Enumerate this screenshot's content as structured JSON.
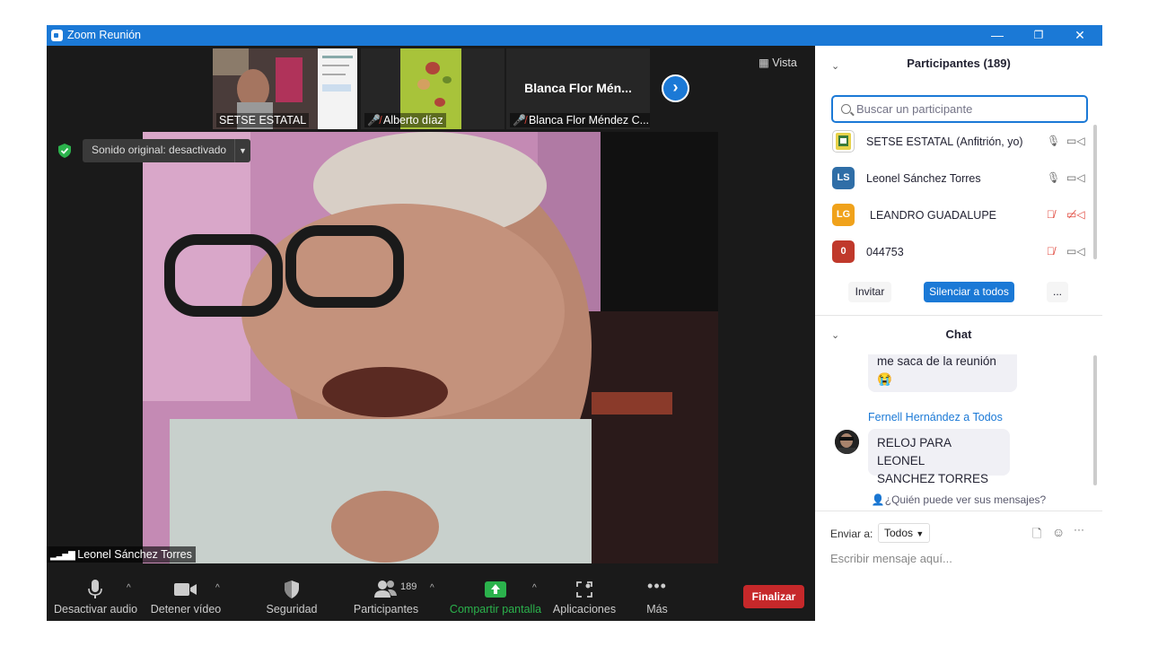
{
  "window": {
    "title": "Zoom Reunión",
    "minimize": "—",
    "restore": "❐",
    "close": "✕"
  },
  "thumbnails": [
    {
      "name": "SETSE ESTATAL",
      "muted": false
    },
    {
      "name": "Alberto díaz",
      "muted": true
    },
    {
      "name": "Blanca Flor Méndez C...",
      "muted": true,
      "display_name": "Blanca Flor Mén..."
    }
  ],
  "view_label": "Vista",
  "original_sound": "Sonido original: desactivado",
  "speaker_name": "Leonel Sánchez Torres",
  "toolbar": {
    "audio": "Desactivar audio",
    "video": "Detener vídeo",
    "security": "Seguridad",
    "participants": "Participantes",
    "participants_count": "189",
    "share": "Compartir pantalla",
    "apps": "Aplicaciones",
    "more": "Más",
    "end": "Finalizar"
  },
  "participants_panel": {
    "title": "Participantes (189)",
    "search_placeholder": "Buscar un participante",
    "participants": [
      {
        "name": "SETSE ESTATAL (Anfitrión, yo)",
        "initials": "",
        "color": "#c9b23a",
        "audio_muted": false,
        "video_off": false
      },
      {
        "name": "Leonel Sánchez Torres",
        "initials": "LS",
        "color": "#2f6ea7",
        "audio_muted": false,
        "video_off": false
      },
      {
        "name": "LEANDRO GUADALUPE",
        "initials": "LG",
        "color": "#f0a21b",
        "audio_muted": true,
        "video_off": true
      },
      {
        "name": "044753",
        "initials": "0",
        "color": "#c0392b",
        "audio_muted": true,
        "video_off": false
      }
    ],
    "invite": "Invitar",
    "mute_all": "Silenciar a todos",
    "more": "..."
  },
  "chat": {
    "title": "Chat",
    "messages": [
      {
        "text": "me saca de la reunión",
        "emoji": "😭"
      },
      {
        "sender": "Fernell Hernández a Todos",
        "text_line1": "RELOJ PARA LEONEL",
        "text_line2": "SANCHEZ TORRES"
      }
    ],
    "who_can_see": "¿Quién puede ver sus mensajes?",
    "send_to_label": "Enviar a:",
    "send_to_value": "Todos",
    "input_placeholder": "Escribir mensaje aquí..."
  }
}
